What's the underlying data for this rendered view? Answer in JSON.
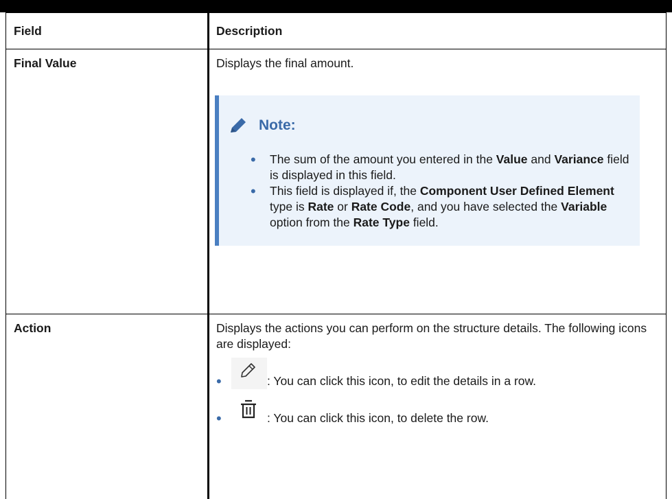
{
  "table": {
    "headers": {
      "field": "Field",
      "description": "Description"
    },
    "rows": [
      {
        "field": "Final Value",
        "description": "Displays the final amount.",
        "note": {
          "title": "Note:",
          "bullets": [
            {
              "segments": [
                {
                  "text": "The sum of the amount you entered in the ",
                  "bold": false
                },
                {
                  "text": "Value",
                  "bold": true
                },
                {
                  "text": " and ",
                  "bold": false
                },
                {
                  "text": "Variance",
                  "bold": true
                },
                {
                  "text": " field is displayed in this field.",
                  "bold": false
                }
              ]
            },
            {
              "segments": [
                {
                  "text": "This field is displayed if, the ",
                  "bold": false
                },
                {
                  "text": "Component User Defined Element",
                  "bold": true
                },
                {
                  "text": " type is ",
                  "bold": false
                },
                {
                  "text": "Rate",
                  "bold": true
                },
                {
                  "text": " or ",
                  "bold": false
                },
                {
                  "text": "Rate Code",
                  "bold": true
                },
                {
                  "text": ", and you have selected the ",
                  "bold": false
                },
                {
                  "text": "Variable",
                  "bold": true
                },
                {
                  "text": " option from the ",
                  "bold": false
                },
                {
                  "text": "Rate Type",
                  "bold": true
                },
                {
                  "text": " field.",
                  "bold": false
                }
              ]
            }
          ]
        }
      },
      {
        "field": "Action",
        "description": "Displays the actions you can perform on the structure details. The following icons are displayed:",
        "icons": [
          {
            "icon": "pencil-icon",
            "text": ": You can click this icon, to edit the details in a row."
          },
          {
            "icon": "trash-icon",
            "text": ": You can click this icon, to delete the row."
          }
        ]
      }
    ]
  },
  "colors": {
    "note_background": "#ecf3fb",
    "note_accent": "#4a7fc1",
    "note_title": "#3a6aa8"
  }
}
